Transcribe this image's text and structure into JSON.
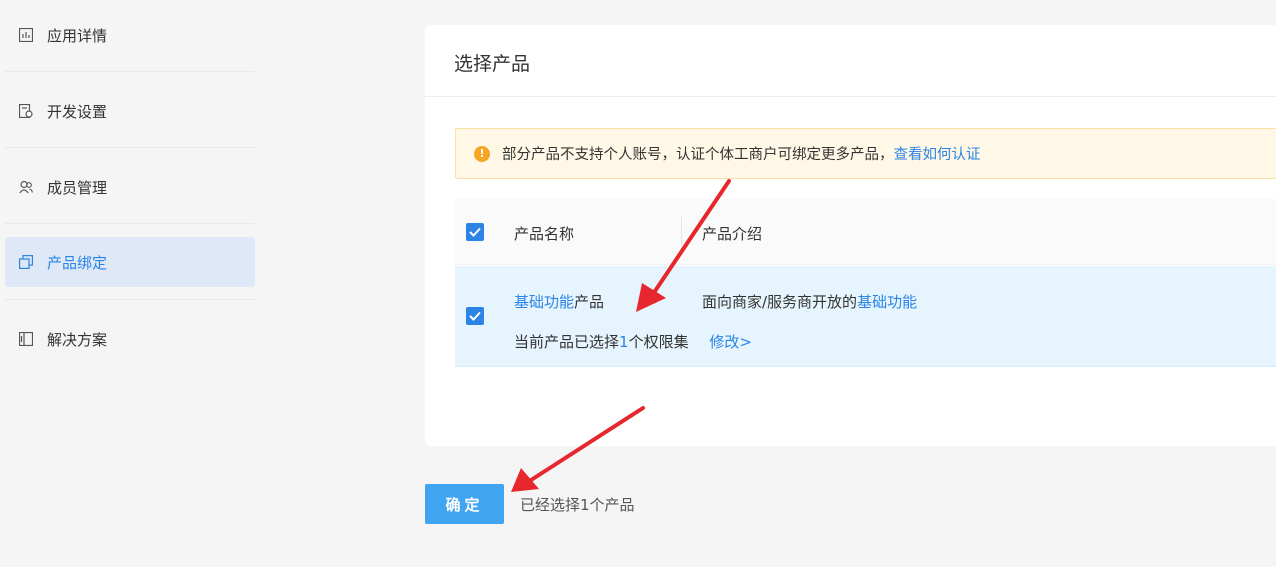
{
  "sidebar": {
    "items": [
      {
        "label": "应用详情",
        "icon": "chart-icon"
      },
      {
        "label": "开发设置",
        "icon": "settings-doc-icon"
      },
      {
        "label": "成员管理",
        "icon": "users-icon"
      },
      {
        "label": "产品绑定",
        "icon": "bind-icon",
        "active": true
      },
      {
        "label": "解决方案",
        "icon": "solution-icon"
      }
    ]
  },
  "card": {
    "title": "选择产品",
    "notice": {
      "text": "部分产品不支持个人账号，认证个体工商户可绑定更多产品，",
      "link": "查看如何认证"
    },
    "table": {
      "headers": [
        "产品名称",
        "产品介绍"
      ],
      "rows": [
        {
          "name_highlight": "基础功能",
          "name_rest": "产品",
          "desc_prefix": "面向商家/服务商开放的",
          "desc_highlight": "基础功能",
          "perm_prefix": "当前产品已选择",
          "perm_count": "1",
          "perm_suffix": "个权限集",
          "modify": "修改>",
          "checked": true
        }
      ]
    }
  },
  "footer": {
    "confirm_label": "确定",
    "selected_text": "已经选择1个产品"
  },
  "colors": {
    "accent": "#2b84e6",
    "confirm": "#3fa5f1",
    "warning": "#f5a623",
    "annotation_arrow": "#e8262d"
  }
}
